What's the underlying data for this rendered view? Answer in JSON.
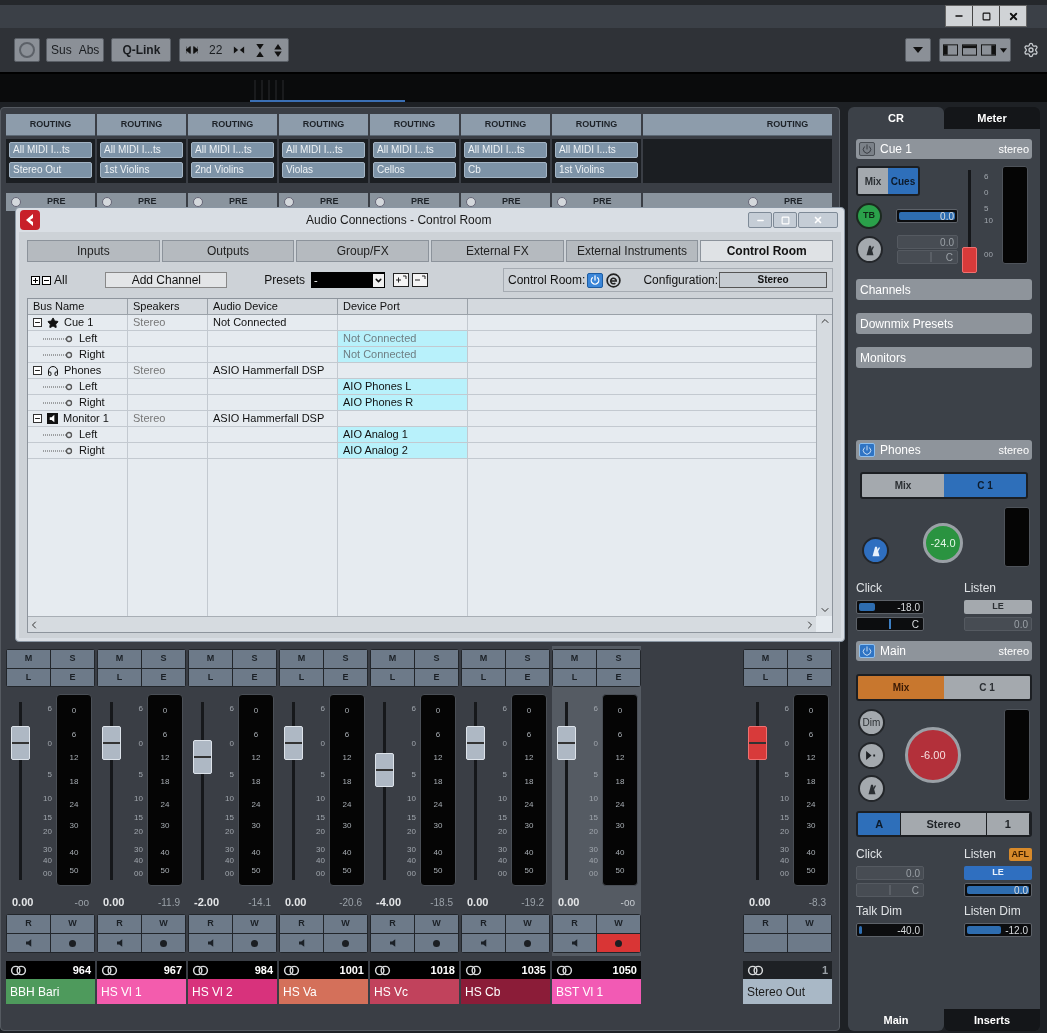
{
  "toolbar": {
    "sus": "Sus",
    "abs": "Abs",
    "qlink": "Q-Link",
    "nudge": "22"
  },
  "mixer": {
    "channels": [
      {
        "kind": "audio",
        "routing": "ROUTING",
        "input": "All MIDI I...ts",
        "output": "Stereo Out",
        "pre": "PRE",
        "buttons": [
          "M",
          "S",
          "L",
          "E"
        ],
        "fader_scale": [
          "6",
          "0",
          "5",
          "10",
          "15",
          "20",
          "30",
          "40",
          "00"
        ],
        "meter_scale": [
          "0",
          "6",
          "12",
          "18",
          "24",
          "30",
          "40",
          "50"
        ],
        "level": 0.77,
        "volume": "0.00",
        "peak": "-oo",
        "automation": [
          "R",
          "W"
        ],
        "record": false,
        "selected": false,
        "number": "964",
        "name": "BBH Bari",
        "color": "#4e9a5c"
      },
      {
        "kind": "audio",
        "routing": "ROUTING",
        "input": "All MIDI I...ts",
        "output": "1st Violins",
        "pre": "PRE",
        "buttons": [
          "M",
          "S",
          "L",
          "E"
        ],
        "fader_scale": [
          "6",
          "0",
          "5",
          "10",
          "15",
          "20",
          "30",
          "40",
          "00"
        ],
        "meter_scale": [
          "0",
          "6",
          "12",
          "18",
          "24",
          "30",
          "40",
          "50"
        ],
        "level": 0.77,
        "volume": "0.00",
        "peak": "-11.9",
        "automation": [
          "R",
          "W"
        ],
        "record": false,
        "selected": false,
        "number": "967",
        "name": "HS Vl 1",
        "color": "#f35cad"
      },
      {
        "kind": "audio",
        "routing": "ROUTING",
        "input": "All MIDI I...ts",
        "output": "2nd Violins",
        "pre": "PRE",
        "buttons": [
          "M",
          "S",
          "L",
          "E"
        ],
        "fader_scale": [
          "6",
          "0",
          "5",
          "10",
          "15",
          "20",
          "30",
          "40",
          "00"
        ],
        "meter_scale": [
          "0",
          "6",
          "12",
          "18",
          "24",
          "30",
          "40",
          "50"
        ],
        "level": 0.69,
        "volume": "-2.00",
        "peak": "-14.1",
        "automation": [
          "R",
          "W"
        ],
        "record": false,
        "selected": false,
        "number": "984",
        "name": "HS Vl 2",
        "color": "#d8327c"
      },
      {
        "kind": "audio",
        "routing": "ROUTING",
        "input": "All MIDI I...ts",
        "output": "Violas",
        "pre": "PRE",
        "buttons": [
          "M",
          "S",
          "L",
          "E"
        ],
        "fader_scale": [
          "6",
          "0",
          "5",
          "10",
          "15",
          "20",
          "30",
          "40",
          "00"
        ],
        "meter_scale": [
          "0",
          "6",
          "12",
          "18",
          "24",
          "30",
          "40",
          "50"
        ],
        "level": 0.77,
        "volume": "0.00",
        "peak": "-20.6",
        "automation": [
          "R",
          "W"
        ],
        "record": false,
        "selected": false,
        "number": "1001",
        "name": "HS Va",
        "color": "#d4705a"
      },
      {
        "kind": "audio",
        "routing": "ROUTING",
        "input": "All MIDI I...ts",
        "output": "Cellos",
        "pre": "PRE",
        "buttons": [
          "M",
          "S",
          "L",
          "E"
        ],
        "fader_scale": [
          "6",
          "0",
          "5",
          "10",
          "15",
          "20",
          "30",
          "40",
          "00"
        ],
        "meter_scale": [
          "0",
          "6",
          "12",
          "18",
          "24",
          "30",
          "40",
          "50"
        ],
        "level": 0.62,
        "volume": "-4.00",
        "peak": "-18.5",
        "automation": [
          "R",
          "W"
        ],
        "record": false,
        "selected": false,
        "number": "1018",
        "name": "HS Vc",
        "color": "#c1425c"
      },
      {
        "kind": "audio",
        "routing": "ROUTING",
        "input": "All MIDI I...ts",
        "output": "Cb",
        "pre": "PRE",
        "buttons": [
          "M",
          "S",
          "L",
          "E"
        ],
        "fader_scale": [
          "6",
          "0",
          "5",
          "10",
          "15",
          "20",
          "30",
          "40",
          "00"
        ],
        "meter_scale": [
          "0",
          "6",
          "12",
          "18",
          "24",
          "30",
          "40",
          "50"
        ],
        "level": 0.77,
        "volume": "0.00",
        "peak": "-19.2",
        "automation": [
          "R",
          "W"
        ],
        "record": false,
        "selected": false,
        "number": "1035",
        "name": "HS Cb",
        "color": "#8b1c38"
      },
      {
        "kind": "audio",
        "routing": "ROUTING",
        "input": "All MIDI I...ts",
        "output": "1st Violins",
        "pre": "PRE",
        "buttons": [
          "M",
          "S",
          "L",
          "E"
        ],
        "fader_scale": [
          "6",
          "0",
          "5",
          "10",
          "15",
          "20",
          "30",
          "40",
          "00"
        ],
        "meter_scale": [
          "0",
          "6",
          "12",
          "18",
          "24",
          "30",
          "40",
          "50"
        ],
        "level": 0.77,
        "volume": "0.00",
        "peak": "-oo",
        "automation": [
          "R",
          "W"
        ],
        "record": true,
        "selected": true,
        "number": "1050",
        "name": "BST Vl 1",
        "color": "#f25ab4"
      },
      {
        "kind": "output",
        "routing": "ROUTING",
        "pre": "PRE",
        "buttons": [
          "M",
          "S",
          "L",
          "E"
        ],
        "fader_scale": [
          "6",
          "0",
          "5",
          "10",
          "15",
          "20",
          "30",
          "40",
          "00"
        ],
        "meter_scale": [
          "0",
          "6",
          "12",
          "18",
          "24",
          "30",
          "40",
          "50"
        ],
        "level": 0.77,
        "volume": "0.00",
        "peak": "-8.3",
        "automation": [
          "R",
          "W"
        ],
        "selected": false,
        "number": "1",
        "name": "Stereo Out",
        "color": "#a9b8c6"
      }
    ]
  },
  "dialog": {
    "title": "Audio Connections - Control Room",
    "tabs": [
      {
        "label": "Inputs",
        "selected": false
      },
      {
        "label": "Outputs",
        "selected": false
      },
      {
        "label": "Group/FX",
        "selected": false
      },
      {
        "label": "External FX",
        "selected": false
      },
      {
        "label": "External Instruments",
        "selected": false
      },
      {
        "label": "Control Room",
        "selected": true
      }
    ],
    "all": "All",
    "add_channel": "Add Channel",
    "presets_label": "Presets",
    "preset_value": "-",
    "control_room_label": "Control Room:",
    "control_room_on": true,
    "configuration_label": "Configuration:",
    "configuration": "Stereo",
    "columns": [
      "Bus Name",
      "Speakers",
      "Audio Device",
      "Device Port"
    ],
    "rows": [
      {
        "kind": "cue",
        "name": "Cue 1",
        "speakers": "Stereo",
        "device": "Not Connected",
        "expanded": true,
        "children": [
          {
            "name": "Left",
            "port": "Not Connected",
            "connected": false
          },
          {
            "name": "Right",
            "port": "Not Connected",
            "connected": false
          }
        ]
      },
      {
        "kind": "phones",
        "name": "Phones",
        "speakers": "Stereo",
        "device": "ASIO Hammerfall DSP",
        "expanded": true,
        "children": [
          {
            "name": "Left",
            "port": "AIO Phones L",
            "connected": true
          },
          {
            "name": "Right",
            "port": "AIO Phones R",
            "connected": true
          }
        ]
      },
      {
        "kind": "monitor",
        "name": "Monitor 1",
        "speakers": "Stereo",
        "device": "ASIO Hammerfall DSP",
        "expanded": true,
        "children": [
          {
            "name": "Left",
            "port": "AIO Analog 1",
            "connected": true
          },
          {
            "name": "Right",
            "port": "AIO Analog 2",
            "connected": true
          }
        ]
      }
    ]
  },
  "control_room": {
    "tabs": [
      {
        "label": "CR",
        "selected": true
      },
      {
        "label": "Meter",
        "selected": false
      }
    ],
    "cue": {
      "title": "Cue 1",
      "format": "stereo",
      "power": false,
      "modes": [
        {
          "label": "Mix",
          "selected": false
        },
        {
          "label": "Cues",
          "selected": true
        }
      ],
      "talkback": "TB",
      "level_slider": {
        "reading": "0.0",
        "level": 1
      },
      "click": {
        "reading": "0.0",
        "disabled": true
      },
      "pan": {
        "value": "C",
        "disabled": true
      },
      "fader_scale": [
        "6",
        "0",
        "5",
        "10",
        "00"
      ],
      "fader": {
        "level": 0.04
      }
    },
    "sections": [
      {
        "label": "Channels"
      },
      {
        "label": "Downmix Presets"
      },
      {
        "label": "Monitors"
      }
    ],
    "phones": {
      "title": "Phones",
      "format": "stereo",
      "power": true,
      "modes": [
        {
          "label": "Mix",
          "selected": false
        },
        {
          "label": "C 1",
          "selected": true
        }
      ],
      "knob": "-24.0",
      "click_label": "Click",
      "click": {
        "reading": "-18.0",
        "level": 0.25,
        "disabled": false
      },
      "pan": {
        "value": "C",
        "disabled": false
      },
      "listen_label": "Listen",
      "listen_button": "LE",
      "listen_active": false,
      "listen": {
        "reading": "0.0",
        "disabled": true
      }
    },
    "main": {
      "title": "Main",
      "format": "stereo",
      "power": true,
      "modes": [
        {
          "label": "Mix",
          "selected": true
        },
        {
          "label": "C 1",
          "selected": false
        }
      ],
      "dim": "Dim",
      "knob": "-6.00",
      "outputs": [
        {
          "label": "A",
          "selected": true
        },
        {
          "label": "Stereo",
          "selected": false
        },
        {
          "label": "1",
          "selected": false
        }
      ],
      "click_label": "Click",
      "click": {
        "reading": "0.0",
        "disabled": true
      },
      "pan": {
        "value": "C",
        "disabled": true
      },
      "listen_label": "Listen",
      "afl": "AFL",
      "listen_button": "LE",
      "listen_active": true,
      "listen": {
        "reading": "0.0",
        "level": 1,
        "disabled": false
      },
      "talk_dim_label": "Talk Dim",
      "talk_dim": {
        "reading": "-40.0",
        "level": 0.05
      },
      "listen_dim_label": "Listen Dim",
      "listen_dim": {
        "reading": "-12.0",
        "level": 0.55
      }
    },
    "bottom_tabs": [
      {
        "label": "Main",
        "selected": true
      },
      {
        "label": "Inserts",
        "selected": false
      }
    ]
  }
}
